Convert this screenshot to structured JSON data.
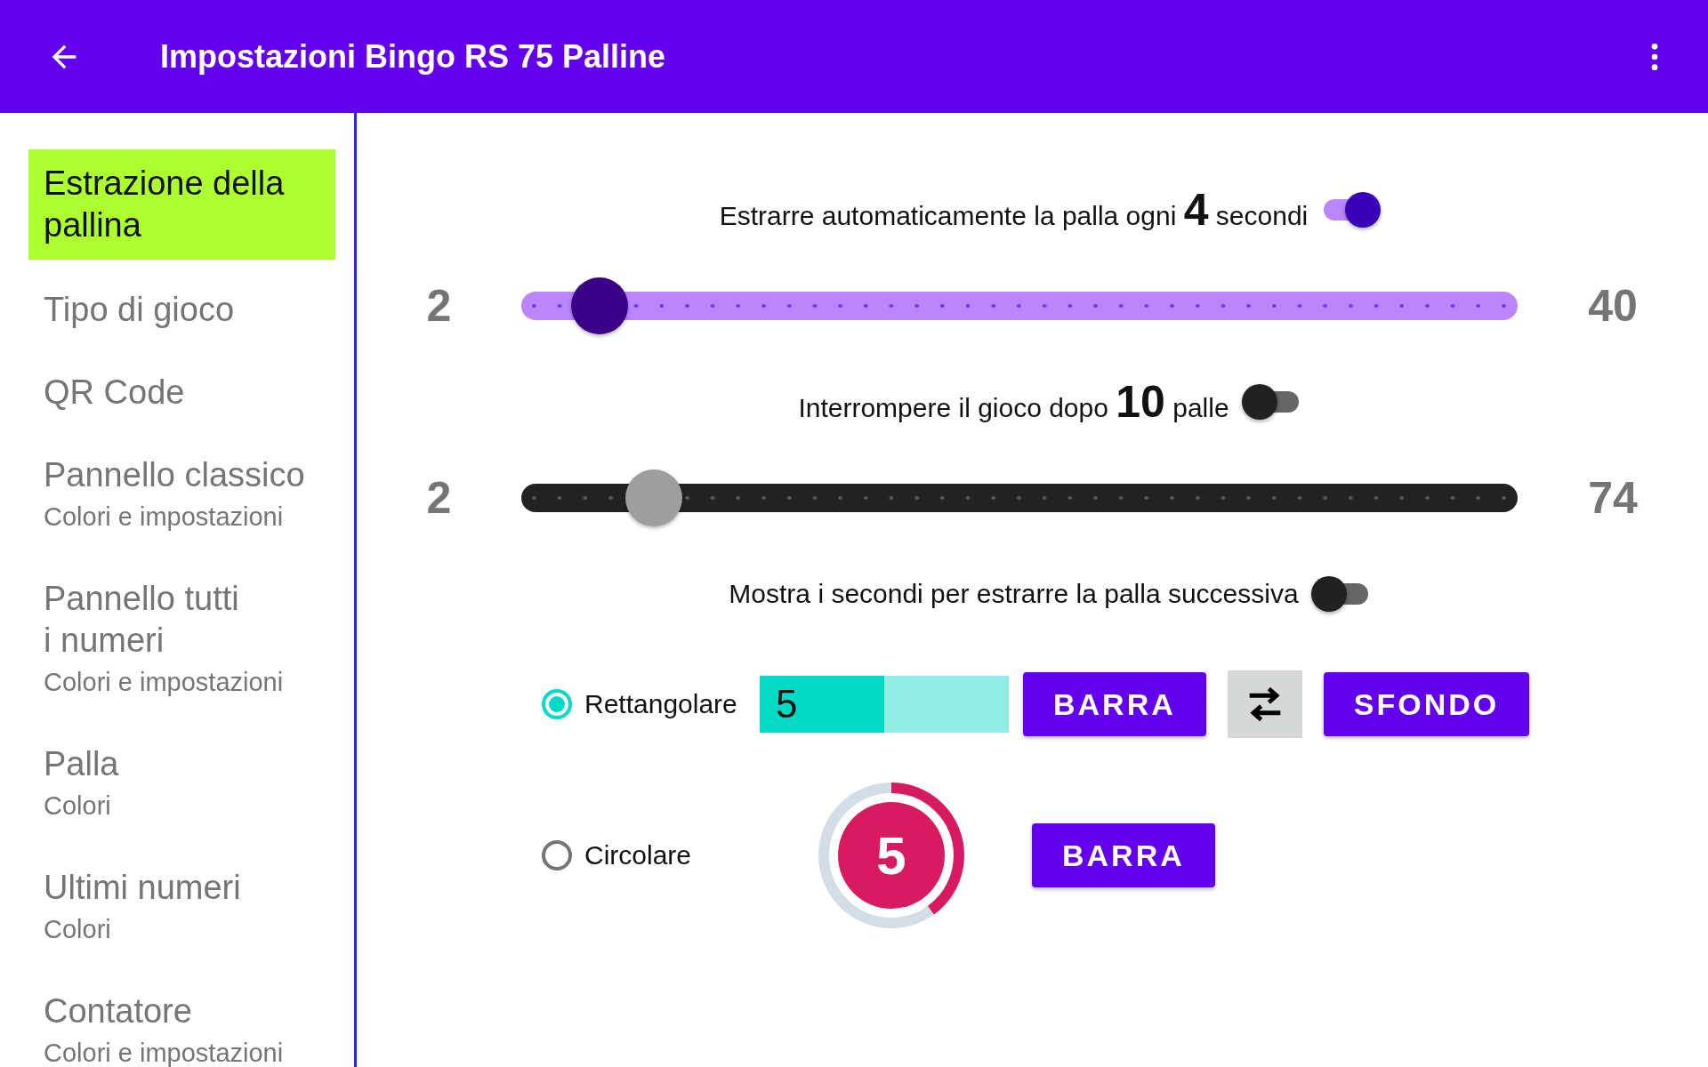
{
  "app_bar": {
    "title": "Impostazioni Bingo RS 75 Palline"
  },
  "sidebar": {
    "items": [
      {
        "title": "Estrazione della pallina",
        "selected": true
      },
      {
        "title": "Tipo di gioco",
        "selected": false
      },
      {
        "title": "QR Code",
        "selected": false
      },
      {
        "title": "Pannello classico",
        "subtitle": "Colori e impostazioni",
        "selected": false
      },
      {
        "title": "Pannello tutti\ni numeri",
        "subtitle": "Colori e impostazioni",
        "selected": false
      },
      {
        "title": "Palla",
        "subtitle": "Colori",
        "selected": false
      },
      {
        "title": "Ultimi numeri",
        "subtitle": "Colori",
        "selected": false
      },
      {
        "title": "Contatore",
        "subtitle": "Colori e impostazioni",
        "selected": false
      }
    ]
  },
  "settings": [
    {
      "kind": "toggle",
      "text": "Estrarre automaticamente la palla ogni **4** secondi",
      "on": true
    },
    {
      "kind": "slider",
      "min": "2",
      "max": "40",
      "level": 0.053,
      "enabled": true
    },
    {
      "kind": "toggle",
      "text": "Interrompere il gioco dopo **10** palle",
      "on": false
    },
    {
      "kind": "slider",
      "min": "2",
      "max": "74",
      "level": 0.111,
      "enabled": false
    },
    {
      "kind": "toggle",
      "text": "Mostra i secondi per estrarre la palla successiva",
      "on": false
    }
  ],
  "indicator_styles": [
    {
      "kind": "bar",
      "label": "Rettangolare",
      "selected": true,
      "value": "5",
      "level": 0.5,
      "buttons": [
        "BARRA",
        "SFONDO"
      ]
    },
    {
      "kind": "ring",
      "label": "Circolare",
      "selected": false,
      "value": "5",
      "level": 0.4,
      "buttons": [
        "BARRA"
      ]
    }
  ]
}
